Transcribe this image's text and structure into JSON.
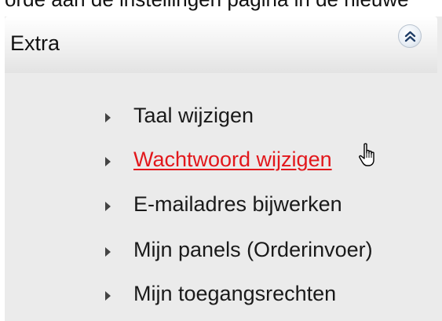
{
  "top_strip": {
    "text": "orde aan de instellingen pagina in de nieuwe"
  },
  "panel": {
    "title": "Extra",
    "collapse_icon": "chevron-double-up-icon",
    "items": [
      {
        "label": "Taal wijzigen",
        "active": false
      },
      {
        "label": "Wachtwoord wijzigen",
        "active": true
      },
      {
        "label": "E-mailadres bijwerken",
        "active": false
      },
      {
        "label": "Mijn panels (Orderinvoer)",
        "active": false
      },
      {
        "label": "Mijn toegangsrechten",
        "active": false
      }
    ]
  },
  "colors": {
    "panel_background": "#ebebeb",
    "active_link": "#e2171b",
    "text": "#1a1a1a"
  },
  "cursor": {
    "icon": "hand-pointer-icon"
  }
}
